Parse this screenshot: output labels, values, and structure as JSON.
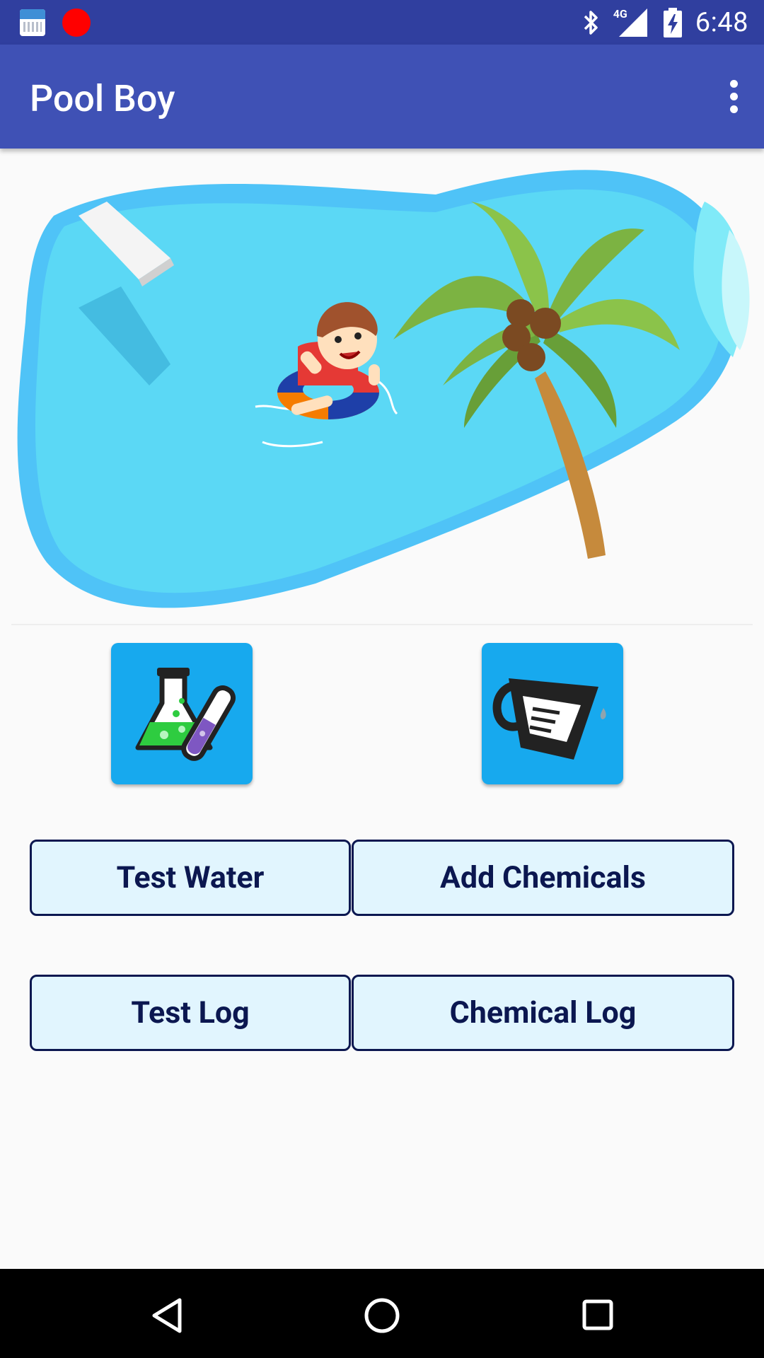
{
  "status_bar": {
    "time": "6:48",
    "network_type": "4G",
    "colors": {
      "background": "#303f9f",
      "record_dot": "#ff0000"
    }
  },
  "app_bar": {
    "title": "Pool Boy",
    "background": "#3f51b5"
  },
  "hero": {
    "illustration": "pool-with-boy-on-float-and-palm-tree"
  },
  "tiles": [
    {
      "icon": "flask-test-tube-icon",
      "background": "#17a9ee"
    },
    {
      "icon": "measuring-cup-icon",
      "background": "#17a9ee"
    }
  ],
  "buttons": {
    "test_water": "Test Water",
    "add_chemicals": "Add Chemicals",
    "test_log": "Test Log",
    "chemical_log": "Chemical Log",
    "style": {
      "fill": "#e1f5fe",
      "border": "#0b1750"
    }
  },
  "nav_bar": {
    "icons": [
      "back-icon",
      "home-icon",
      "recents-icon"
    ]
  }
}
